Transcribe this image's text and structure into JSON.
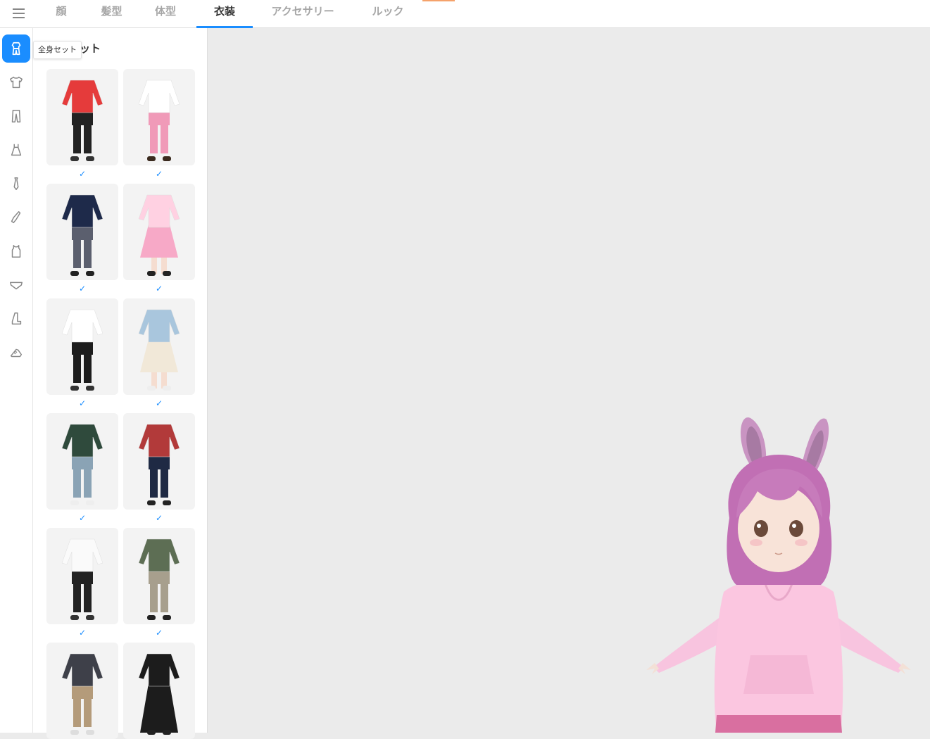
{
  "topbar": {
    "menu_icon": "hamburger-menu-icon",
    "tabs": [
      {
        "label": "顔"
      },
      {
        "label": "髪型"
      },
      {
        "label": "体型"
      },
      {
        "label": "衣装"
      },
      {
        "label": "アクセサリー"
      },
      {
        "label": "ルック"
      }
    ],
    "active_tab": "衣装",
    "accent_color": "#1a8dff"
  },
  "rail": {
    "items": [
      {
        "icon": "full-outfit-icon",
        "active": true
      },
      {
        "icon": "tshirt-icon"
      },
      {
        "icon": "pants-icon"
      },
      {
        "icon": "dress-icon"
      },
      {
        "icon": "tie-icon"
      },
      {
        "icon": "sock-icon"
      },
      {
        "icon": "tank-top-icon"
      },
      {
        "icon": "underwear-icon"
      },
      {
        "icon": "boot-icon"
      },
      {
        "icon": "shoe-icon"
      }
    ],
    "tooltip": "全身セット"
  },
  "panel": {
    "title_visible_part": "ット",
    "check_mark": "✓",
    "outfits": [
      {
        "name": "red-hoodie-shorts-outfit"
      },
      {
        "name": "pink-skirt-blouse-outfit"
      },
      {
        "name": "navy-blazer-uniform-outfit"
      },
      {
        "name": "pink-maid-dress-outfit"
      },
      {
        "name": "sailor-top-shorts-outfit"
      },
      {
        "name": "denim-jacket-cream-dress-outfit"
      },
      {
        "name": "floral-shirt-denim-shorts-outfit"
      },
      {
        "name": "red-floral-shirt-jeans-outfit"
      },
      {
        "name": "white-crop-top-leggings-outfit"
      },
      {
        "name": "green-hoodie-plaid-skirt-outfit"
      },
      {
        "name": "gray-shirt-leopard-pants-outfit"
      },
      {
        "name": "black-long-dress-outfit"
      }
    ]
  },
  "viewport": {
    "background": "#ebebeb",
    "avatar": "pink-haired-bunny-eared-character-in-pink-hoodie"
  }
}
